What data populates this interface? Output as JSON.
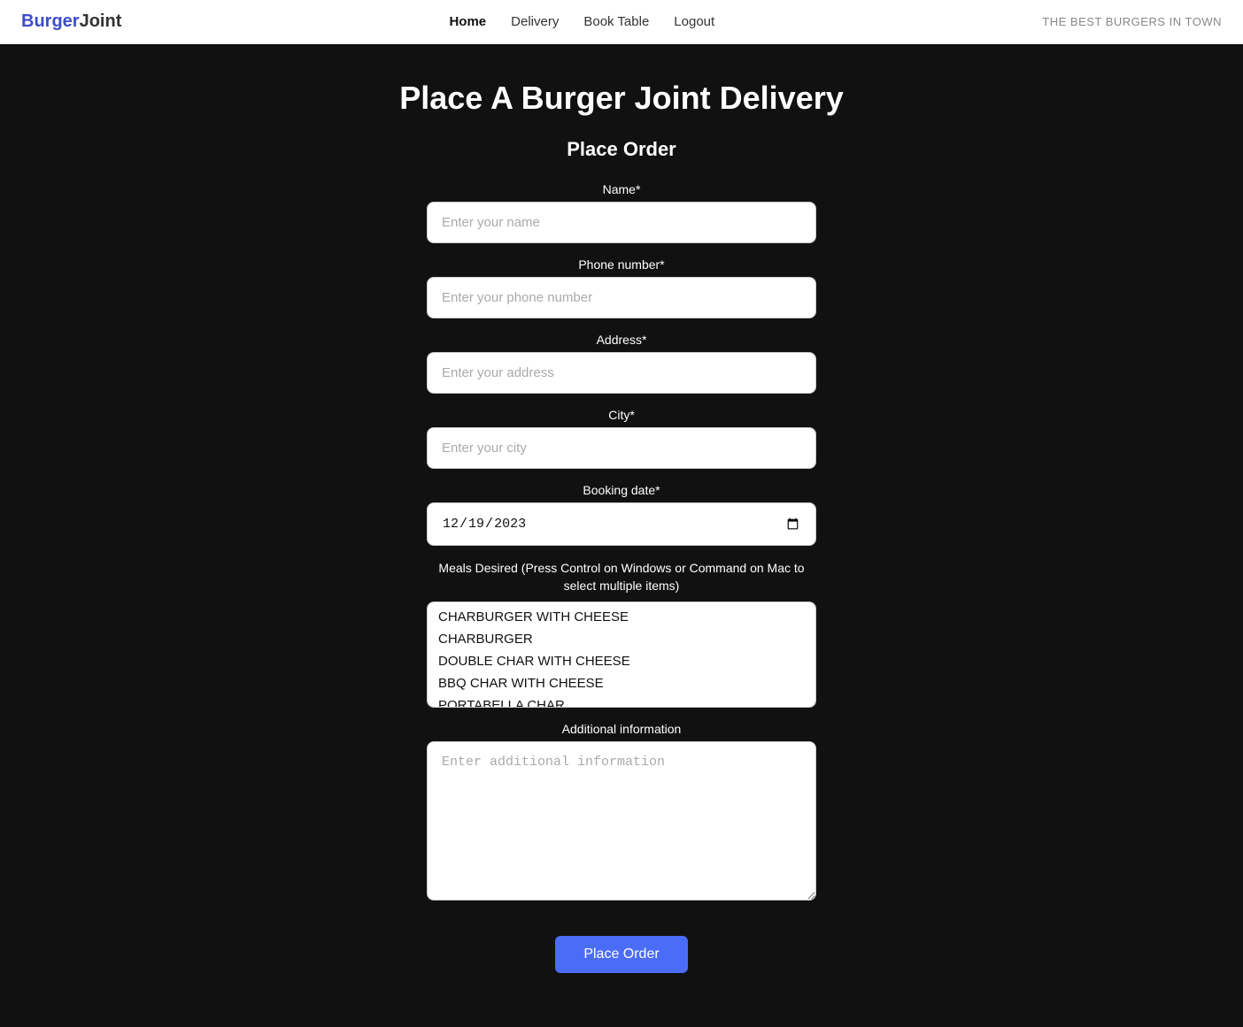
{
  "navbar": {
    "logo_burger": "Burger",
    "logo_joint": "Joint",
    "nav_items": [
      {
        "label": "Home",
        "active": true
      },
      {
        "label": "Delivery",
        "active": false
      },
      {
        "label": "Book Table",
        "active": false
      },
      {
        "label": "Logout",
        "active": false
      }
    ],
    "tagline": "THE BEST BURGERS IN TOWN"
  },
  "page": {
    "title": "Place A Burger Joint Delivery",
    "form_title": "Place Order",
    "fields": {
      "name_label": "Name*",
      "name_placeholder": "Enter your name",
      "phone_label": "Phone number*",
      "phone_placeholder": "Enter your phone number",
      "address_label": "Address*",
      "address_placeholder": "Enter your address",
      "city_label": "City*",
      "city_placeholder": "Enter your city",
      "booking_date_label": "Booking date*",
      "booking_date_value": "19.12.2023",
      "meals_label": "Meals Desired (Press Control on Windows or Command on Mac to select multiple items)",
      "meals_options": [
        "CHARBURGER WITH CHEESE",
        "CHARBURGER",
        "DOUBLE CHAR WITH CHEESE",
        "BBQ CHAR WITH CHEESE",
        "PORTABELLA CHAR"
      ],
      "additional_label": "Additional information",
      "additional_placeholder": "Enter additional information"
    },
    "submit_label": "Place Order"
  }
}
